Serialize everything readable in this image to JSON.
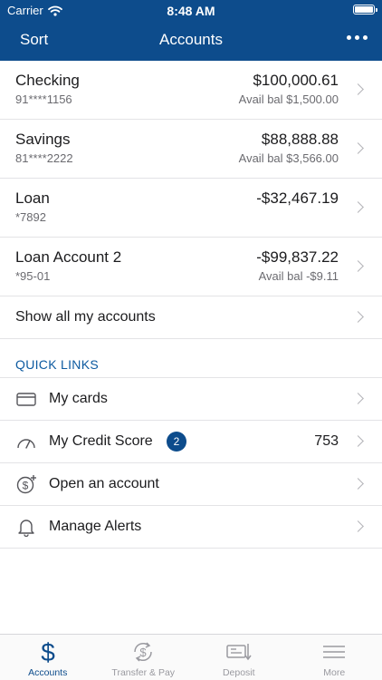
{
  "status_bar": {
    "carrier": "Carrier",
    "time": "8:48 AM"
  },
  "nav": {
    "left_label": "Sort",
    "title": "Accounts",
    "more_icon": "more-horizontal-icon"
  },
  "accounts": [
    {
      "name": "Checking",
      "number": "91****1156",
      "balance": "$100,000.61",
      "available": "Avail bal $1,500.00"
    },
    {
      "name": "Savings",
      "number": "81****2222",
      "balance": "$88,888.88",
      "available": "Avail bal $3,566.00"
    },
    {
      "name": "Loan",
      "number": "*7892",
      "balance": "-$32,467.19",
      "available": ""
    },
    {
      "name": "Loan Account 2",
      "number": "*95-01",
      "balance": "-$99,837.22",
      "available": "Avail bal -$9.11"
    }
  ],
  "show_all_label": "Show all my accounts",
  "quick_links": {
    "heading": "QUICK LINKS",
    "items": [
      {
        "label": "My cards",
        "icon": "credit-card-icon"
      },
      {
        "label": "My Credit Score",
        "icon": "gauge-icon",
        "badge": "2",
        "value": "753"
      },
      {
        "label": "Open an account",
        "icon": "dollar-plus-icon"
      },
      {
        "label": "Manage Alerts",
        "icon": "bell-icon"
      }
    ]
  },
  "tabs": [
    {
      "label": "Accounts",
      "icon": "dollar-icon",
      "active": true
    },
    {
      "label": "Transfer & Pay",
      "icon": "transfer-dollar-icon",
      "active": false
    },
    {
      "label": "Deposit",
      "icon": "check-deposit-icon",
      "active": false
    },
    {
      "label": "More",
      "icon": "menu-icon",
      "active": false
    }
  ],
  "colors": {
    "brand": "#0d4c8c",
    "link_heading": "#0d5aa0",
    "separator": "#e3e3e6"
  }
}
